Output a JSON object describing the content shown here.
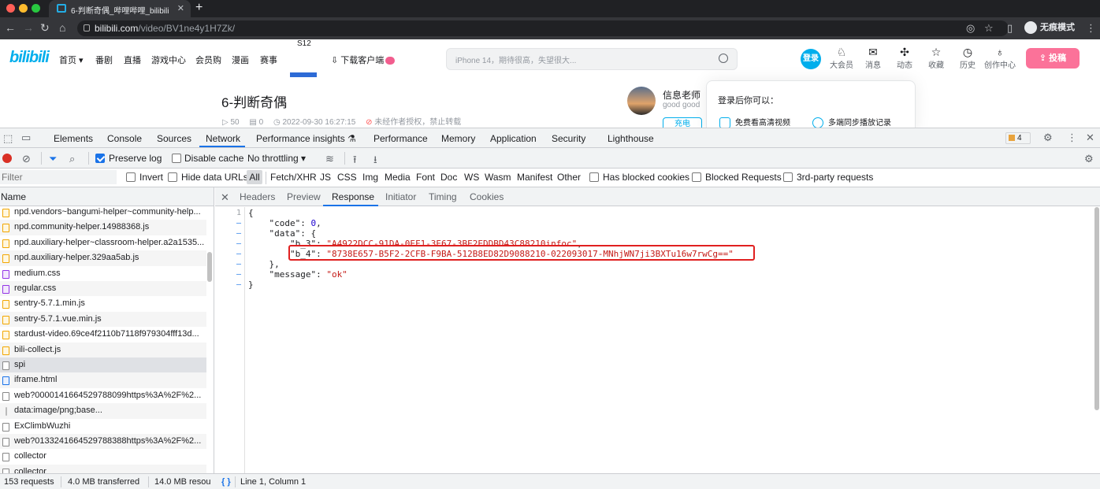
{
  "browser": {
    "tab_title": "6-判断奇偶_哔哩哔哩_bilibili",
    "url_domain": "bilibili.com",
    "url_path": "/video/BV1ne4y1H7Zk/",
    "profile_label": "无痕模式"
  },
  "site": {
    "logo": "bilibili",
    "nav": [
      "首页",
      "番剧",
      "直播",
      "游戏中心",
      "会员购",
      "漫画",
      "赛事"
    ],
    "promo": "S12",
    "download": "下载客户端",
    "search_placeholder": "iPhone 14，期待很高，失望很大...",
    "login": "登录",
    "entries": [
      "大会员",
      "消息",
      "动态",
      "收藏",
      "历史",
      "创作中心"
    ],
    "upload": "投稿",
    "video_title": "6-判断奇偶",
    "views": "50",
    "danmaku": "0",
    "date": "2022-09-30 16:27:15",
    "copyright": "未经作者授权，禁止转载",
    "up_name": "信息老师",
    "up_desc": "good good",
    "charge": "充电",
    "popup_title": "登录后你可以：",
    "popup_features": [
      "免费看高清视频",
      "多端同步播放记录"
    ]
  },
  "devtools": {
    "tabs": [
      "Elements",
      "Console",
      "Sources",
      "Network",
      "Performance insights",
      "Performance",
      "Memory",
      "Application",
      "Security",
      "Lighthouse"
    ],
    "active_tab": "Network",
    "issues_count": "4",
    "toolbar": {
      "preserve_log": "Preserve log",
      "disable_cache": "Disable cache",
      "throttling": "No throttling"
    },
    "filter": {
      "placeholder": "Filter",
      "invert": "Invert",
      "hide_data_urls": "Hide data URLs",
      "types": [
        "All",
        "Fetch/XHR",
        "JS",
        "CSS",
        "Img",
        "Media",
        "Font",
        "Doc",
        "WS",
        "Wasm",
        "Manifest",
        "Other"
      ],
      "has_blocked_cookies": "Has blocked cookies",
      "blocked_requests": "Blocked Requests",
      "third_party": "3rd-party requests"
    },
    "request_list": {
      "header": "Name",
      "rows": [
        {
          "name": "npd.vendors~bangumi-helper~community-help...",
          "type": "js"
        },
        {
          "name": "npd.community-helper.14988368.js",
          "type": "js"
        },
        {
          "name": "npd.auxiliary-helper~classroom-helper.a2a1535...",
          "type": "js"
        },
        {
          "name": "npd.auxiliary-helper.329aa5ab.js",
          "type": "js"
        },
        {
          "name": "medium.css",
          "type": "css"
        },
        {
          "name": "regular.css",
          "type": "css"
        },
        {
          "name": "sentry-5.7.1.min.js",
          "type": "js"
        },
        {
          "name": "sentry-5.7.1.vue.min.js",
          "type": "js"
        },
        {
          "name": "stardust-video.69ce4f2110b7118f979304fff13d...",
          "type": "js"
        },
        {
          "name": "bili-collect.js",
          "type": "js"
        },
        {
          "name": "spi",
          "type": "other"
        },
        {
          "name": "iframe.html",
          "type": "doc"
        },
        {
          "name": "web?0000141664529788099https%3A%2F%2...",
          "type": "other"
        },
        {
          "name": "data:image/png;base...",
          "type": "img"
        },
        {
          "name": "ExClimbWuzhi",
          "type": "other"
        },
        {
          "name": "web?0133241664529788388https%3A%2F%2...",
          "type": "other"
        },
        {
          "name": "collector",
          "type": "other"
        },
        {
          "name": "collector",
          "type": "other"
        }
      ],
      "selected_index": 10
    },
    "detail_tabs": [
      "Headers",
      "Preview",
      "Response",
      "Initiator",
      "Timing",
      "Cookies"
    ],
    "active_detail_tab": "Response",
    "response": {
      "code_key": "\"code\"",
      "code_val": "0",
      "data_key": "\"data\"",
      "b3_key": "\"b_3\"",
      "b3_val": "\"A4922DCC-91DA-0EF1-3E67-3BE2EDDBD43C88210infoc\"",
      "b4_key": "\"b_4\"",
      "b4_val": "\"8738E657-B5F2-2CFB-F9BA-512B8ED82D9088210-022093017-MNhjWN7ji3BXTu16w7rwCg==\"",
      "message_key": "\"message\"",
      "message_val": "\"ok\"",
      "first_line_number": "1"
    },
    "status": {
      "requests": "153 requests",
      "transferred": "4.0 MB transferred",
      "resources": "14.0 MB resou",
      "position": "Line 1, Column 1",
      "braces": "{ }"
    }
  },
  "colors": {
    "bilibili_blue": "#00aeec",
    "upload_pink": "#fb7299",
    "devtools_accent": "#1a73e8",
    "highlight_red": "#e02020"
  }
}
